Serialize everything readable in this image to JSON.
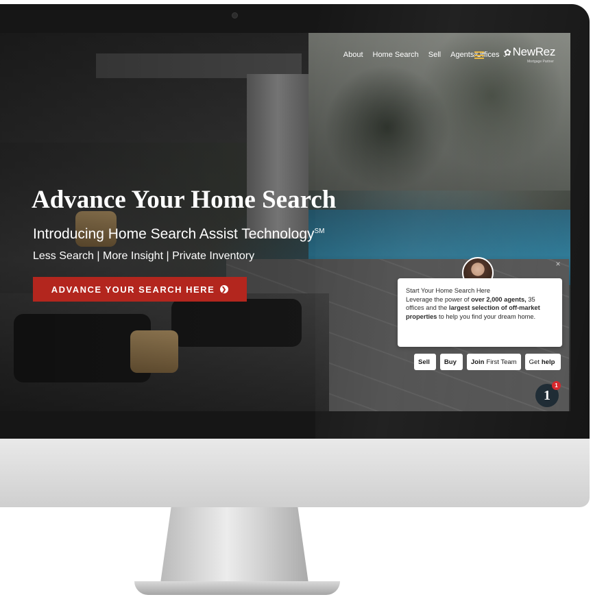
{
  "nav": {
    "items": [
      "About",
      "Home Search",
      "Sell",
      "Agents/Offices"
    ],
    "dropdown_chevron": "chevron-down-icon",
    "menu_icon": "hamburger-menu-icon",
    "menu_color": "#e8b43a"
  },
  "logo": {
    "brand": "NewRez",
    "tagline": "Mortgage Partner"
  },
  "hero": {
    "title": "Advance Your Home Search",
    "subtitle_main": "Introducing Home Search Assist Technology",
    "subtitle_mark": "SM",
    "tagline": "Less Search | More Insight | Private Inventory",
    "cta_label": "ADVANCE YOUR SEARCH HERE",
    "cta_color": "#b3261e"
  },
  "chat": {
    "heading": "Start Your Home Search Here",
    "text_1": "Leverage the power of ",
    "bold_1": "over 2,000 agents,",
    "text_2": " 35 offices and the ",
    "bold_2": "largest selection of off-market properties",
    "text_3": " to help you find your dream home.",
    "buttons": {
      "sell": "Sell",
      "buy": "Buy",
      "join_bold": "Join",
      "join_rest": "First Team",
      "help_plain": "Get",
      "help_bold": "help"
    },
    "badge_number": "1",
    "notification_count": "1",
    "notification_color": "#d6262b"
  }
}
